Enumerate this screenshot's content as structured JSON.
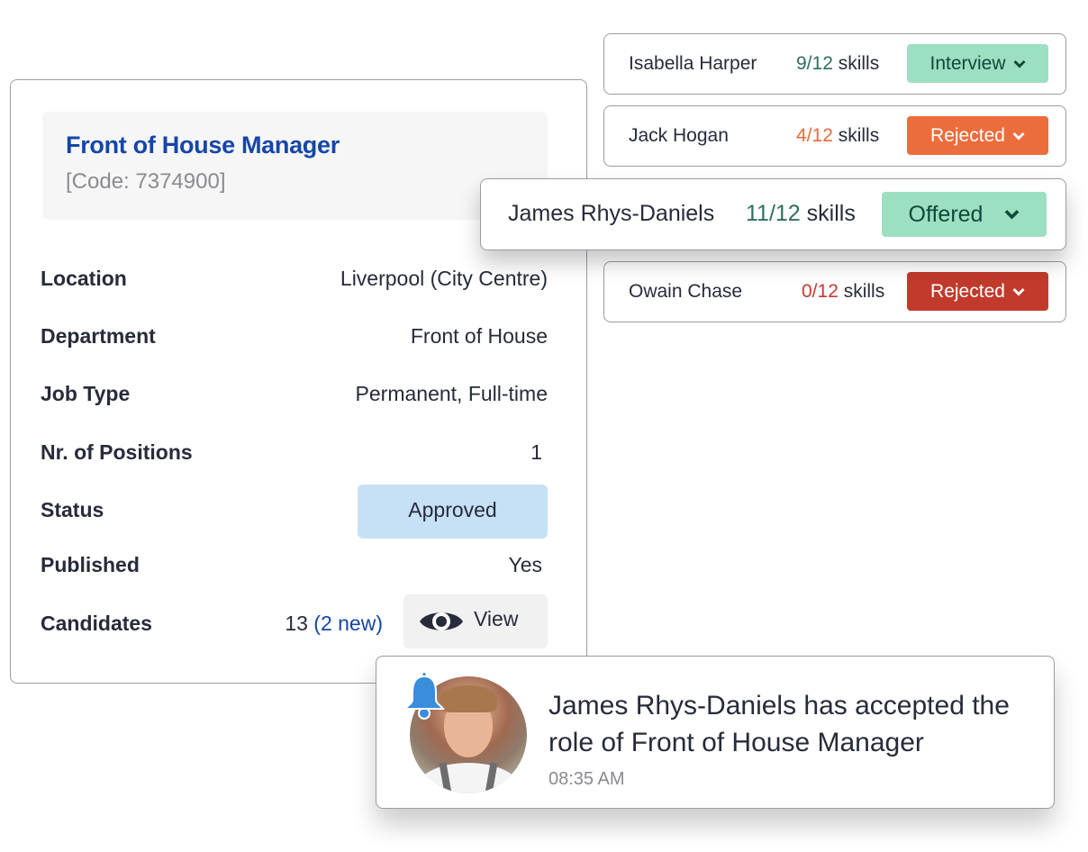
{
  "job": {
    "title": "Front of House Manager",
    "code": "[Code: 7374900]",
    "details": [
      {
        "label": "Location",
        "value": "Liverpool (City Centre)"
      },
      {
        "label": "Department",
        "value": "Front of House"
      },
      {
        "label": "Job Type",
        "value": "Permanent, Full-time"
      },
      {
        "label": "Nr. of Positions",
        "value": "1"
      },
      {
        "label": "Status",
        "value": "Approved"
      },
      {
        "label": "Published",
        "value": "Yes"
      },
      {
        "label": "Candidates",
        "value": "13",
        "new": "(2 new)"
      }
    ],
    "view_label": "View",
    "colors": {
      "title": "#1546a8",
      "status_bg": "#c6e0f6"
    }
  },
  "candidates": [
    {
      "name": "Isabella Harper",
      "score": "9/12",
      "skills_label": "skills",
      "status": "Interview",
      "score_color": "#2f6e5e",
      "status_bg": "#9ddfc2",
      "status_fg": "#0d4a3a"
    },
    {
      "name": "Jack Hogan",
      "score": "4/12",
      "skills_label": "skills",
      "status": "Rejected",
      "score_color": "#e96a3c",
      "status_bg": "#ec6c3c",
      "status_fg": "#ffffff"
    },
    {
      "name": "James Rhys-Daniels",
      "score": "11/12",
      "skills_label": "skills",
      "status": "Offered",
      "score_color": "#2f6e5e",
      "status_bg": "#9ddfc2",
      "status_fg": "#0d4a3a"
    },
    {
      "name": "Owain Chase",
      "score": "0/12",
      "skills_label": "skills",
      "status": "Rejected",
      "score_color": "#c93a2e",
      "status_bg": "#c23a2c",
      "status_fg": "#ffffff"
    }
  ],
  "notification": {
    "message": "James Rhys-Daniels has accepted the role of Front of House Manager",
    "time": "08:35 AM",
    "icon": "bell-icon",
    "bell_color": "#3a8ddb"
  }
}
